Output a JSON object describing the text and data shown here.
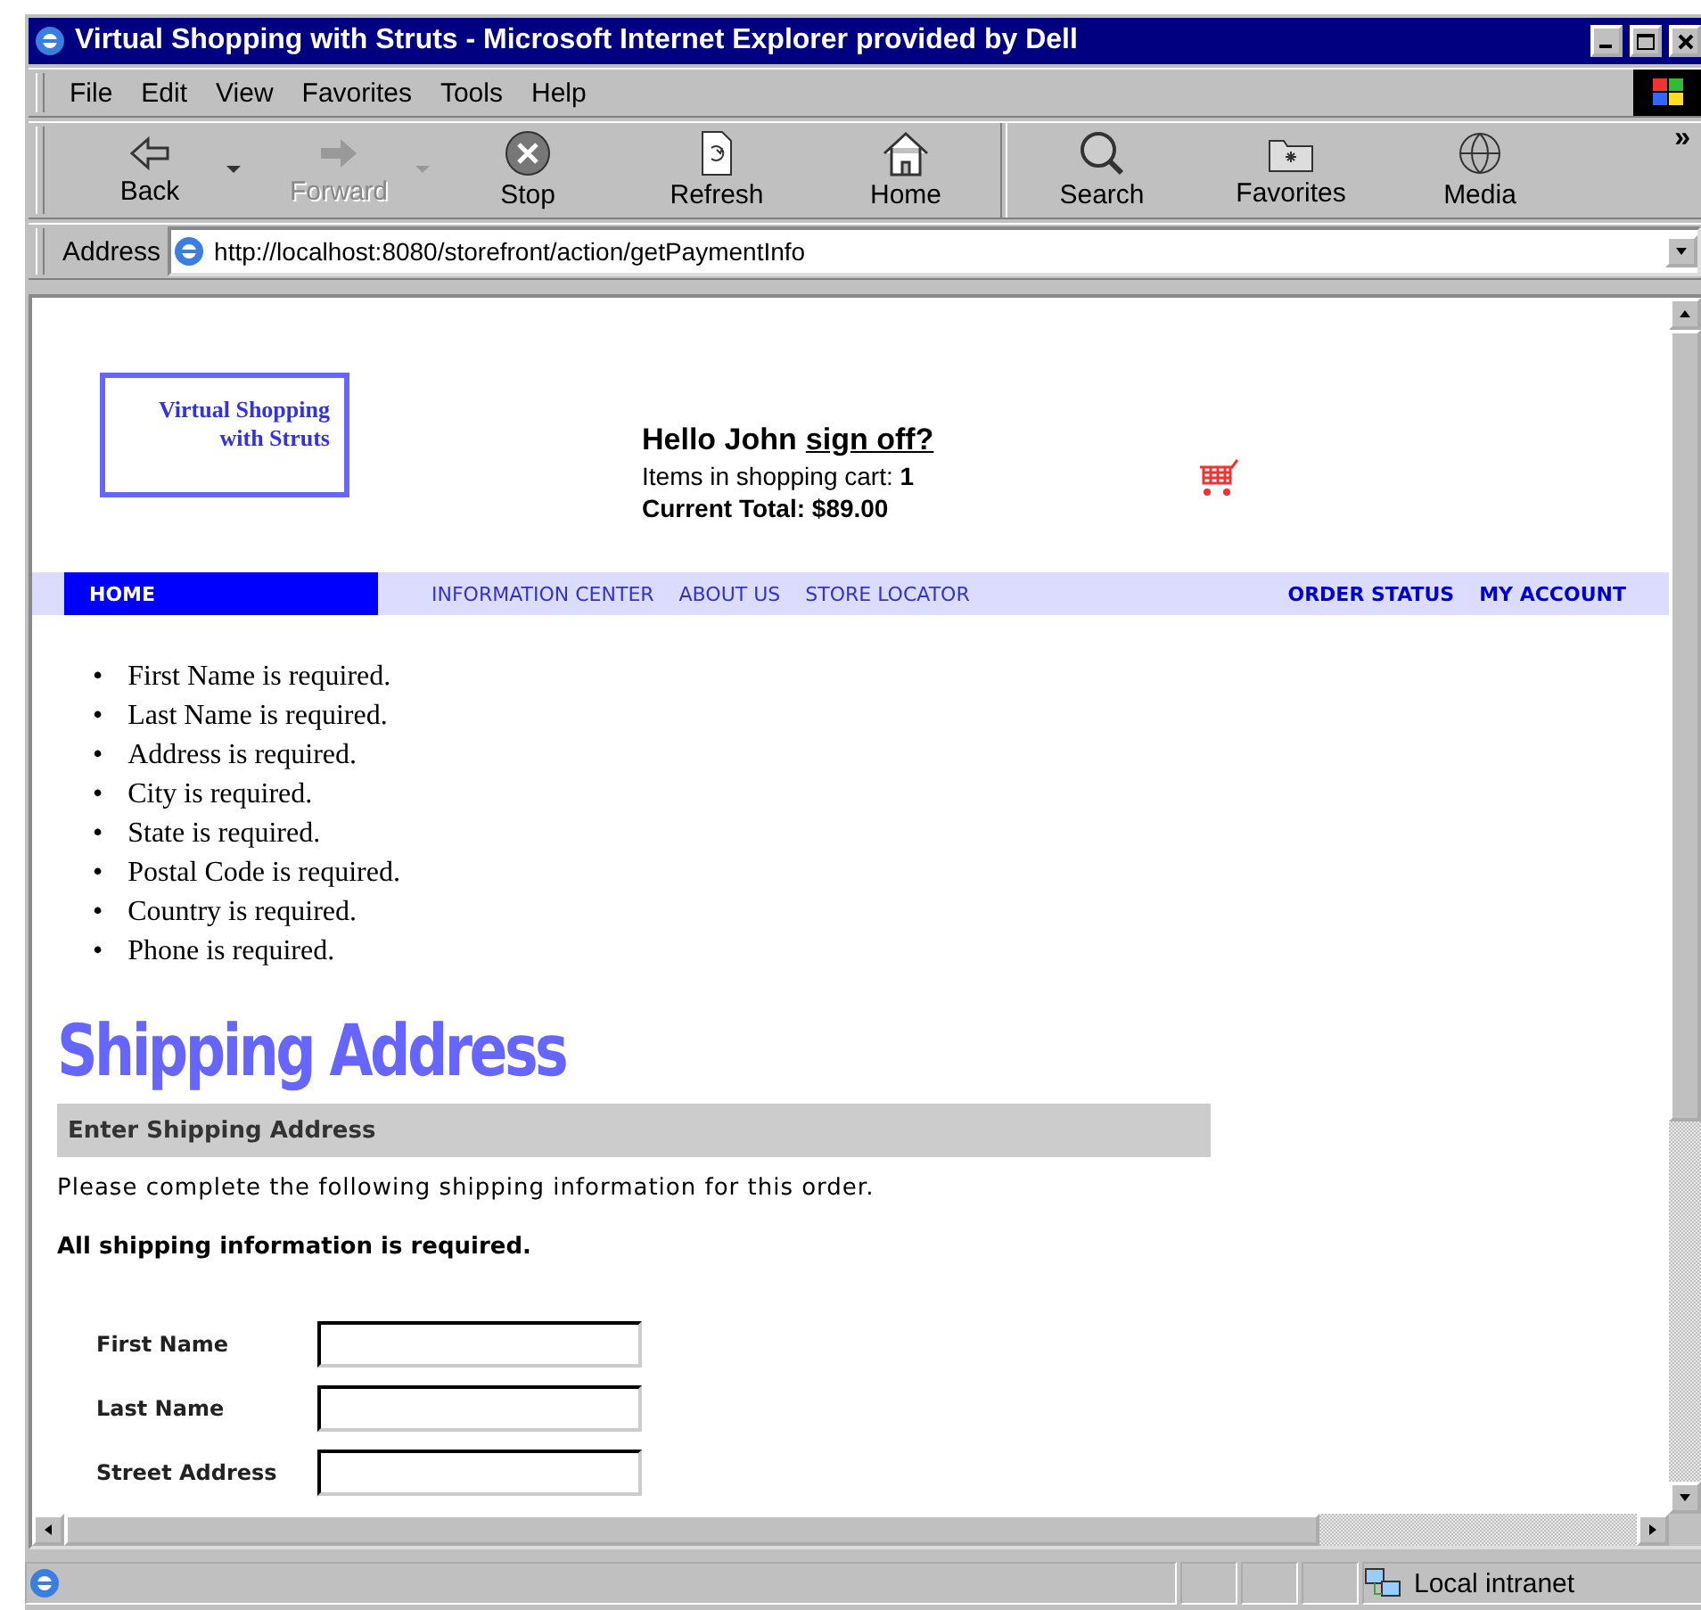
{
  "window": {
    "title": "Virtual Shopping with Struts - Microsoft Internet Explorer provided by Dell"
  },
  "menu": [
    "File",
    "Edit",
    "View",
    "Favorites",
    "Tools",
    "Help"
  ],
  "toolbar": [
    {
      "label": "Back",
      "kind": "back",
      "disabled": false,
      "dropdown": true
    },
    {
      "label": "Forward",
      "kind": "forward",
      "disabled": true,
      "dropdown": true
    },
    {
      "label": "Stop",
      "kind": "stop",
      "disabled": false,
      "dropdown": false
    },
    {
      "label": "Refresh",
      "kind": "refresh",
      "disabled": false,
      "dropdown": false
    },
    {
      "label": "Home",
      "kind": "home",
      "disabled": false,
      "dropdown": false
    },
    {
      "label": "Search",
      "kind": "search",
      "disabled": false,
      "dropdown": false
    },
    {
      "label": "Favorites",
      "kind": "favorites",
      "disabled": false,
      "dropdown": false
    },
    {
      "label": "Media",
      "kind": "media",
      "disabled": false,
      "dropdown": false
    }
  ],
  "toolbar_more": "»",
  "address": {
    "label": "Address",
    "value": "http://localhost:8080/storefront/action/getPaymentInfo"
  },
  "page": {
    "logo": [
      "Virtual Shopping",
      "with Struts"
    ],
    "greeting": "Hello John",
    "sign_off": "sign off?",
    "cart_label": "Items in shopping cart:",
    "cart_count": "1",
    "total": "Current Total: $89.00",
    "nav_left": [
      {
        "label": "HOME",
        "selected": true
      }
    ],
    "nav_middle": [
      "INFORMATION CENTER",
      "ABOUT US",
      "STORE LOCATOR"
    ],
    "nav_right": [
      "ORDER STATUS",
      "MY ACCOUNT"
    ],
    "bullet": "•",
    "errors": [
      "First Name is required.",
      "Last Name is required.",
      "Address is required.",
      "City is required.",
      "State is required.",
      "Postal Code is required.",
      "Country is required.",
      "Phone is required."
    ],
    "heading": "Shipping Address",
    "section": "Enter Shipping Address",
    "intro": "Please complete the following shipping information for this order.",
    "note": "All shipping information is required.",
    "fields": [
      {
        "label": "First Name"
      },
      {
        "label": "Last Name"
      },
      {
        "label": "Street Address"
      }
    ]
  },
  "status_bar": {
    "zone": "Local intranet"
  }
}
